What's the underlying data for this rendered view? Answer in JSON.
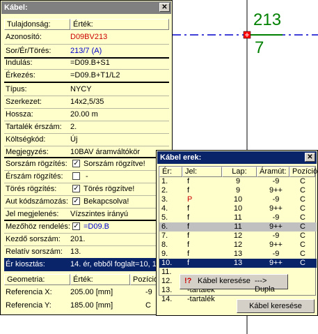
{
  "drawing": {
    "top_number": "213",
    "bottom_number": "7"
  },
  "kabel_window": {
    "title": "Kábel:",
    "close_label": "✕",
    "col_property": "Tulajdonság:",
    "col_value": "Érték:",
    "rows": [
      {
        "label": "Azonosító:",
        "value": "D09BV213"
      },
      {
        "label": "Sor/Ér/Törés:",
        "value": "213/7 (A)"
      },
      {
        "label": "Indulás:",
        "value": "=D09.B+S1"
      },
      {
        "label": "Érkezés:",
        "value": "=D09.B+T1/L2"
      },
      {
        "label": "Típus:",
        "value": "NYCY"
      },
      {
        "label": "Szerkezet:",
        "value": "14x2,5/35"
      },
      {
        "label": "Hossza:",
        "value": "20.00 m"
      },
      {
        "label": "Tartalék érszám:",
        "value": "2."
      },
      {
        "label": "Költségkód:",
        "value": "Új"
      },
      {
        "label": "Megjegyzés:",
        "value": "10BAV áramváltókör"
      },
      {
        "label": "Sorszám rögzítés:",
        "value": "Sorszám rögzítve!"
      },
      {
        "label": "Érszám rögzítés:",
        "value": "-"
      },
      {
        "label": "Törés rögzítés:",
        "value": "Törés rögzítve!"
      },
      {
        "label": "Aut kódszámozás:",
        "value": "Bekapcsolva!"
      },
      {
        "label": "Jel megjelenés:",
        "value": "Vízszintes irányú"
      },
      {
        "label": "Mezőhöz rendelés:",
        "value": "=D09.B"
      },
      {
        "label": "Kezdő sorszám:",
        "value": "201."
      },
      {
        "label": "Relatív sorszám:",
        "value": "13."
      },
      {
        "label": "Ér kiosztás:",
        "value": "14. ér, ebből foglalt=10, 1"
      }
    ],
    "checkboxes": {
      "sorszam": true,
      "erszam": false,
      "tores": true,
      "aut": true,
      "mezo": true
    },
    "geometry_headers": {
      "col1": "Geometria:",
      "col2": "Érték:",
      "col3": "Pozíció"
    },
    "geometry_rows": [
      {
        "label": "Referencia X:",
        "value": "205.00 [mm]",
        "pos": "-9"
      },
      {
        "label": "Referencia Y:",
        "value": "185.00 [mm]",
        "pos": "C"
      }
    ]
  },
  "erek_window": {
    "title": "Kábel erek:",
    "close_label": "✕",
    "headers": {
      "er": "Ér:",
      "jel": "Jel:",
      "lap": "Lap:",
      "aramut": "Áramút:",
      "pozicio": "Pozíció:"
    },
    "rows": [
      {
        "er": "1.",
        "jel": "f",
        "lap": "9",
        "aramut": "-9",
        "pozicio": "C"
      },
      {
        "er": "2.",
        "jel": "f",
        "lap": "9",
        "aramut": "9++",
        "pozicio": "C"
      },
      {
        "er": "3.",
        "jel": "P",
        "lap": "10",
        "aramut": "-9",
        "pozicio": "C"
      },
      {
        "er": "4.",
        "jel": "f",
        "lap": "10",
        "aramut": "9++",
        "pozicio": "C"
      },
      {
        "er": "5.",
        "jel": "f",
        "lap": "11",
        "aramut": "-9",
        "pozicio": "C"
      },
      {
        "er": "6.",
        "jel": "f",
        "lap": "11",
        "aramut": "9++",
        "pozicio": "C"
      },
      {
        "er": "7.",
        "jel": "f",
        "lap": "12",
        "aramut": "-9",
        "pozicio": "C"
      },
      {
        "er": "8.",
        "jel": "f",
        "lap": "12",
        "aramut": "9++",
        "pozicio": "C"
      },
      {
        "er": "9.",
        "jel": "f",
        "lap": "13",
        "aramut": "-9",
        "pozicio": "C"
      },
      {
        "er": "10.",
        "jel": "f",
        "lap": "13",
        "aramut": "9++",
        "pozicio": "C"
      },
      {
        "er": "11.",
        "jel": "",
        "lap": "",
        "aramut": "",
        "pozicio": ""
      },
      {
        "er": "12.",
        "jel": "",
        "lap": "",
        "aramut": "",
        "pozicio": ""
      },
      {
        "er": "13.",
        "jel": "-tartalék",
        "lap": "",
        "aramut": "",
        "pozicio": ""
      },
      {
        "er": "14.",
        "jel": "-tartalék",
        "lap": "",
        "aramut": "",
        "pozicio": ""
      }
    ],
    "context_menu": {
      "icon_text": "!?",
      "label": "Kábel keresése",
      "arrow": "---> Dupla"
    },
    "search_button": "Kábel keresése"
  }
}
